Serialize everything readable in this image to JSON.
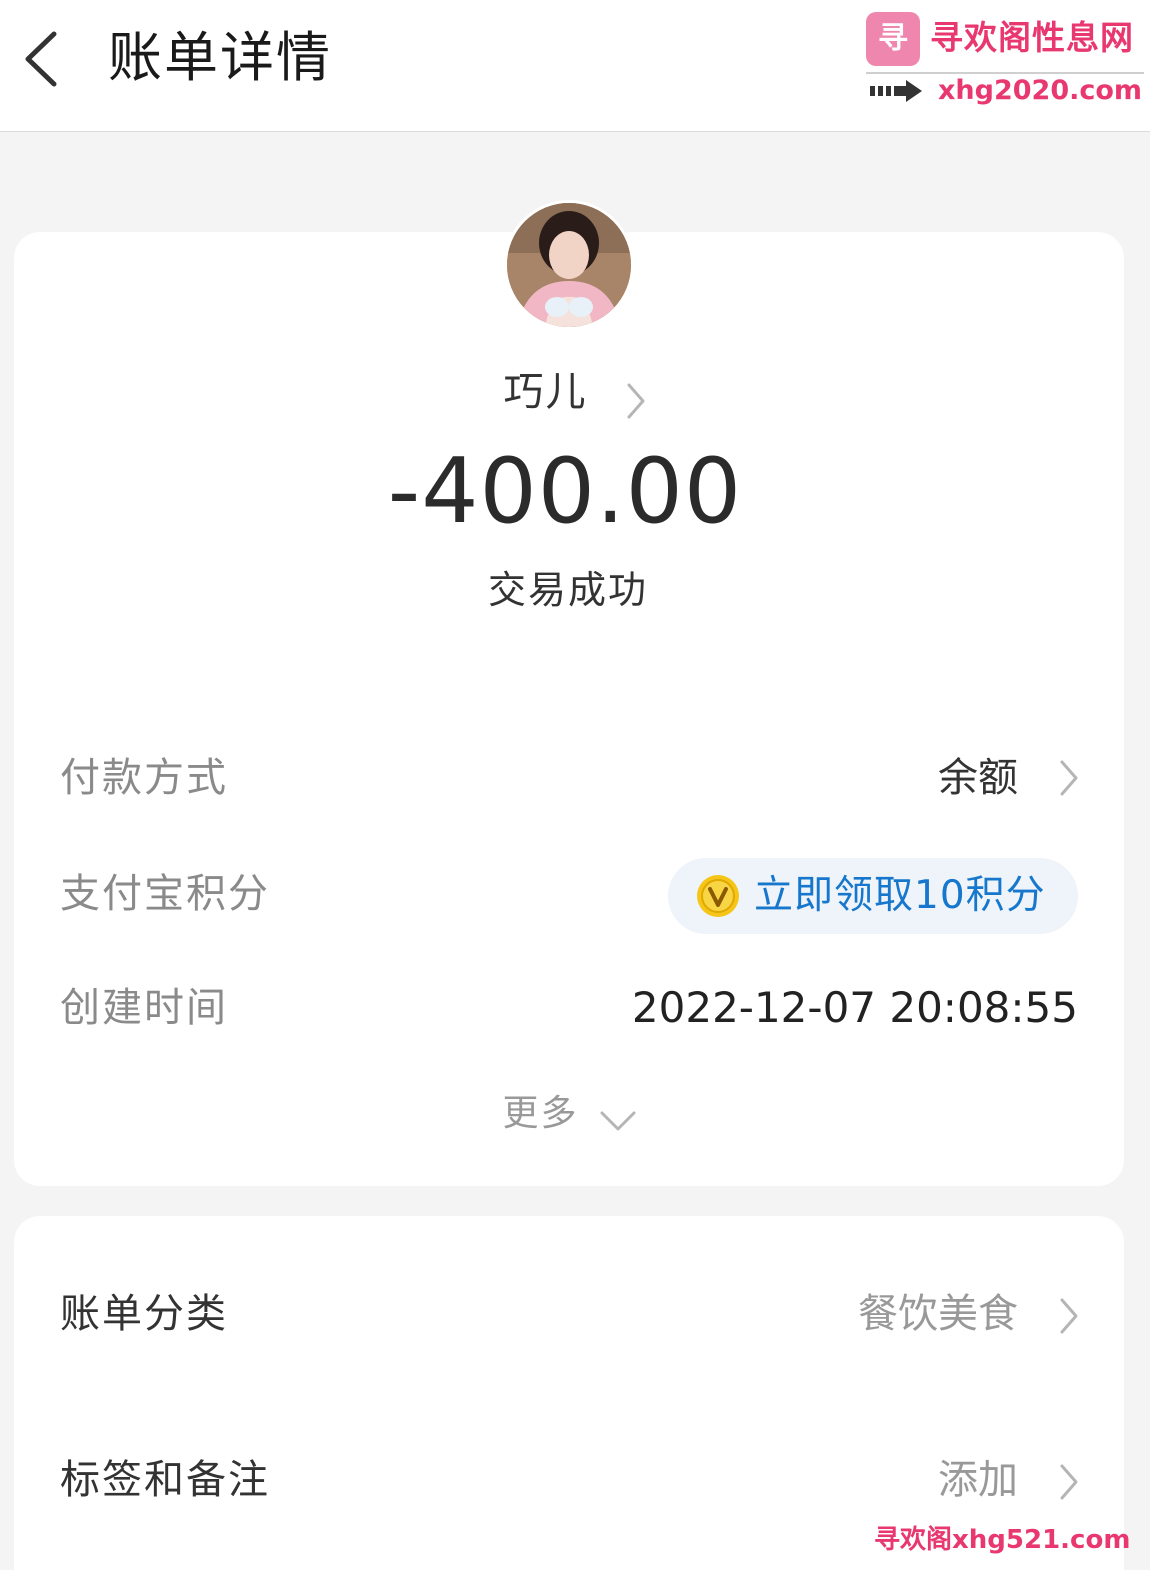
{
  "header": {
    "title": "账单详情"
  },
  "watermark": {
    "logo_text": "寻",
    "site_name": "寻欢阁性息网",
    "site_url": "xhg2020.com",
    "bottom_text": "寻欢阁xhg521.com"
  },
  "payee": {
    "name": "巧儿"
  },
  "transaction": {
    "amount": "-400.00",
    "status": "交易成功"
  },
  "details": {
    "payment_method_label": "付款方式",
    "payment_method_value": "余额",
    "points_label": "支付宝积分",
    "points_action": "立即领取10积分",
    "created_label": "创建时间",
    "created_value": "2022-12-07 20:08:55",
    "more_label": "更多"
  },
  "extras": {
    "category_label": "账单分类",
    "category_value": "餐饮美食",
    "tags_label": "标签和备注",
    "tags_value": "添加"
  },
  "colors": {
    "accent_blue": "#1677cc",
    "pill_bg": "#eef4fa",
    "coin_gold": "#f5c518",
    "watermark_pink": "#e8386f"
  },
  "icons": {
    "back": "back-arrow-icon",
    "chevron": "chevron-right-icon",
    "more": "chevron-down-icon",
    "coin": "coin-icon"
  }
}
